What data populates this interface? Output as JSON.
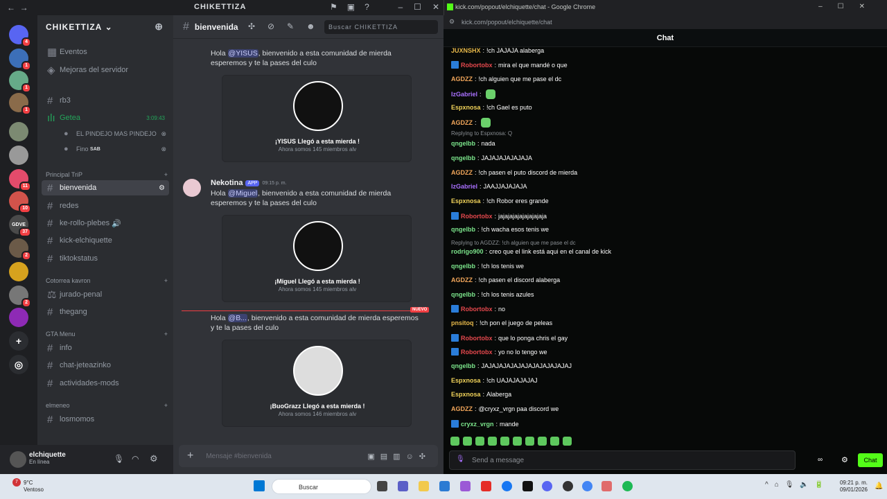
{
  "discord": {
    "window_title": "CHIKETTIZA",
    "guild_name": "CHIKETTIZA",
    "top_items": [
      "Eventos",
      "Mejoras del servidor"
    ],
    "voice": {
      "text_channel": "rb3",
      "voice_channel": "Getea",
      "timer": "3:09:43",
      "members": [
        {
          "name": "EL PINDEJO MAS PINDEJO"
        },
        {
          "name": "Fino",
          "tag": "SAB"
        }
      ]
    },
    "categories": [
      {
        "name": "Principal TriP",
        "channels": [
          "bienvenida",
          "redes",
          "ke-rollo-plebes",
          "kick-elchiquette",
          "tiktokstatus"
        ]
      },
      {
        "name": "Cotorrea kavron",
        "channels": [
          "jurado-penal",
          "thegang"
        ]
      },
      {
        "name": "GTA Menu",
        "channels": [
          "info",
          "chat-jeteazinko",
          "actividades-mods"
        ]
      },
      {
        "name": "elmeneo",
        "channels": [
          "losmomos"
        ]
      }
    ],
    "server_badges": [
      "4",
      "1",
      "1",
      "1",
      "",
      "",
      "11",
      "10",
      "37",
      "2",
      "",
      "2"
    ],
    "server_labels": [
      "GDVE"
    ],
    "user": {
      "name": "elchiquette",
      "status": "En línea"
    },
    "chat": {
      "channel": "bienvenida",
      "search_placeholder": "Buscar CHIKETTIZA",
      "composer_placeholder": "Mensaje #bienvenida",
      "new_label": "NUEVO",
      "messages": [
        {
          "greeting": "Hola",
          "mention": "@YISUS",
          "text": ", bienvenido a esta comunidad de mierda esperemos y te la pases del culo",
          "card_title": "¡YISUS Llegó a esta mierda !",
          "card_sub": "Ahora somos 145 miembros alv"
        },
        {
          "author": "Nekotina",
          "app_badge": "APP",
          "time": "09:15 p. m.",
          "greeting": "Hola",
          "mention": "@Miguel",
          "text": ", bienvenido a esta comunidad de mierda esperemos y te la pases del culo",
          "card_title": "¡Miguel Llegó a esta mierda !",
          "card_sub": "Ahora somos 145 miembros alv"
        },
        {
          "greeting": "Hola",
          "mention": "@B...",
          "text": ", bienvenido a esta comunidad de mierda esperemos y te la pases del culo",
          "card_title": "¡BuoGrazz Llegó a esta mierda !",
          "card_sub": "Ahora somos 146 miembros alv"
        }
      ]
    }
  },
  "kick": {
    "window_title": "kick.com/popout/elchiquette/chat - Google Chrome",
    "address": "kick.com/popout/elchiquette/chat",
    "header": "Chat",
    "input_placeholder": "Send a message",
    "send_label": "Chat",
    "messages": [
      {
        "user": "JUXNSHX",
        "color": "#e8b94a",
        "text": "!ch JAJAJA alaberga"
      },
      {
        "user": "Robortobx",
        "color": "#e5484d",
        "text": "mira el que mandé o que",
        "badge": true
      },
      {
        "user": "AGDZZ",
        "color": "#f2a65a",
        "text": "!ch alguien que me pase el dc"
      },
      {
        "user": "IzGabriel",
        "color": "#a970ff",
        "text": "",
        "emote": true
      },
      {
        "user": "Espxnosa",
        "color": "#f1d35a",
        "text": "!ch Gael es puto"
      },
      {
        "user": "AGDZZ",
        "color": "#f2a65a",
        "text": "",
        "emote": true
      },
      {
        "reply": "Replying to Espxnosa: Q"
      },
      {
        "user": "qngelbb",
        "color": "#7be48b",
        "text": "nada"
      },
      {
        "user": "qngelbb",
        "color": "#7be48b",
        "text": "JAJAJAJAJAJAJA"
      },
      {
        "user": "AGDZZ",
        "color": "#f2a65a",
        "text": "!ch pasen el puto discord de mierda"
      },
      {
        "user": "IzGabriel",
        "color": "#a970ff",
        "text": "JAAJJAJAJAJA"
      },
      {
        "user": "Espxnosa",
        "color": "#f1d35a",
        "text": "!ch Robor eres grande"
      },
      {
        "user": "Robortobx",
        "color": "#e5484d",
        "text": "jajajajajajajajajaja",
        "badge": true
      },
      {
        "user": "qngelbb",
        "color": "#7be48b",
        "text": "!ch wacha esos tenis we"
      },
      {
        "reply": "Replying to AGDZZ: !ch alguien que me pase el dc"
      },
      {
        "user": "rodrigo900",
        "color": "#7be48b",
        "text": "creo que el link está aqui en el canal de kick"
      },
      {
        "user": "qngelbb",
        "color": "#7be48b",
        "text": "!ch los tenis we"
      },
      {
        "user": "AGDZZ",
        "color": "#f2a65a",
        "text": "!ch pasen el discord alaberga"
      },
      {
        "user": "qngelbb",
        "color": "#7be48b",
        "text": "!ch los tenis azules"
      },
      {
        "user": "Robortobx",
        "color": "#e5484d",
        "text": "no",
        "badge": true
      },
      {
        "user": "pnsitoq",
        "color": "#e8b94a",
        "text": "!ch pon el juego de peleas"
      },
      {
        "user": "Robortobx",
        "color": "#e5484d",
        "text": "que lo ponga chris el gay",
        "badge": true
      },
      {
        "user": "Robortobx",
        "color": "#e5484d",
        "text": "yo no lo tengo we",
        "badge": true
      },
      {
        "user": "qngelbb",
        "color": "#7be48b",
        "text": "JAJAJAJAJAJAJAJAJAJAJAJAJ"
      },
      {
        "user": "Espxnosa",
        "color": "#f1d35a",
        "text": "!ch UAJAJAJAJAJ"
      },
      {
        "user": "Espxnosa",
        "color": "#f1d35a",
        "text": "Alaberga"
      },
      {
        "user": "AGDZZ",
        "color": "#f2a65a",
        "text": "@cryxz_vrgn paa discord we"
      },
      {
        "user": "cryxz_vrgn",
        "color": "#7be48b",
        "text": "mande",
        "badge": true
      }
    ]
  },
  "taskbar": {
    "weather_temp": "9°C",
    "weather_desc": "Ventoso",
    "weather_alert": "7",
    "search_placeholder": "Buscar",
    "time": "09:21 p. m.",
    "date": "09/01/2026"
  }
}
